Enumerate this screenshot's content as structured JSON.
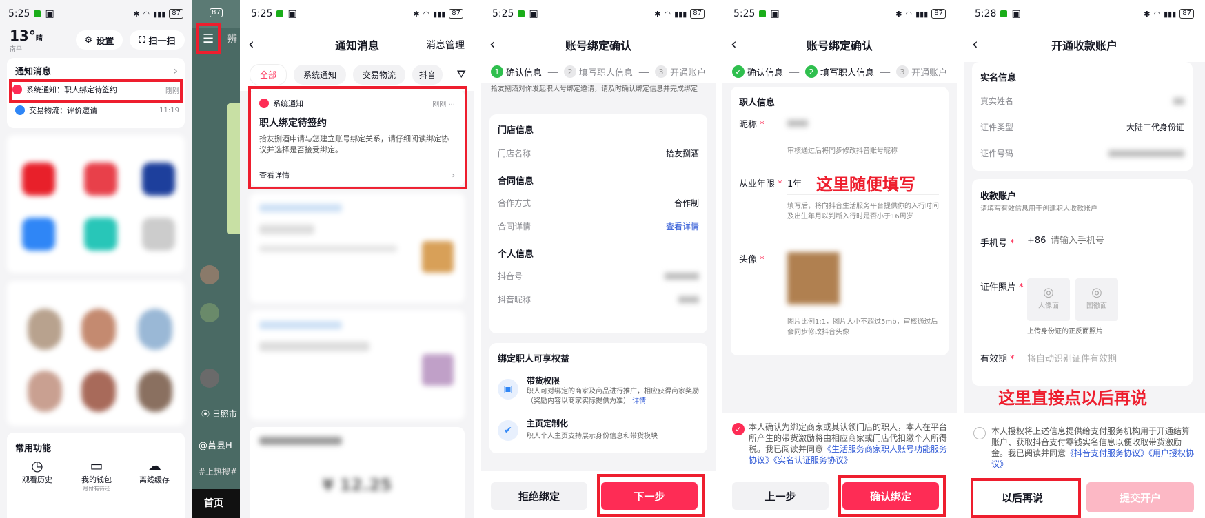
{
  "colors": {
    "brand": "#fe2c55",
    "highlight": "#ee1e2e",
    "success": "#2fbf4e",
    "link": "#2f59d6"
  },
  "p1": {
    "status": {
      "time": "5:25",
      "battery": "87"
    },
    "weather": {
      "temp": "13°",
      "cond": "晴",
      "city": "南平"
    },
    "top": {
      "settings": "设置",
      "scan": "扫一扫"
    },
    "notif": {
      "title": "通知消息",
      "items": [
        {
          "label": "系统通知：职人绑定待签约",
          "time": "刚刚"
        },
        {
          "label": "交易物流：评价邀请",
          "time": "11:19"
        }
      ]
    },
    "common": {
      "title": "常用功能",
      "items": [
        {
          "label": "观看历史"
        },
        {
          "label": "我的钱包",
          "sub": "月付有待还"
        },
        {
          "label": "离线缓存"
        }
      ]
    }
  },
  "p2": {
    "label": "辨",
    "tab": "首页",
    "tags": "#上热搜#",
    "nav": "日照市",
    "hot": "@莒县H"
  },
  "p3": {
    "status": {
      "time": "5:25",
      "battery": "87"
    },
    "title": "通知消息",
    "manage": "消息管理",
    "tabs": [
      "全部",
      "系统通知",
      "交易物流",
      "抖音"
    ],
    "card": {
      "source": "系统通知",
      "time": "刚刚",
      "title": "职人绑定待签约",
      "body": "拾友捌酒申请与您建立账号绑定关系，请仔细阅读绑定协议并选择是否接受绑定。",
      "link": "查看详情"
    },
    "amount": "¥ 12.25"
  },
  "p4": {
    "status": {
      "time": "5:25",
      "battery": "87"
    },
    "title": "账号绑定确认",
    "steps": [
      "确认信息",
      "填写职人信息",
      "开通账户"
    ],
    "intro": "拾友捌酒对你发起职人号绑定邀请，请及时确认绑定信息并完成绑定",
    "store": {
      "section": "门店信息",
      "name_label": "门店名称",
      "name": "拾友捌酒"
    },
    "contract": {
      "section": "合同信息",
      "mode_label": "合作方式",
      "mode": "合作制",
      "detail_label": "合同详情",
      "detail": "查看详情"
    },
    "personal": {
      "section": "个人信息",
      "dy_label": "抖音号",
      "nick_label": "抖音昵称"
    },
    "benefits": {
      "title": "绑定职人可享权益",
      "b1_title": "带货权限",
      "b1_desc": "职人可对绑定的商家及商品进行推广，相应获得商家奖励（奖励内容以商家实际提供为准）",
      "b1_link": "详情",
      "b2_title": "主页定制化",
      "b2_desc": "职人个人主页支持展示身份信息和带货模块"
    },
    "reject": "拒绝绑定",
    "next": "下一步"
  },
  "p5": {
    "status": {
      "time": "5:25",
      "battery": "87"
    },
    "title": "账号绑定确认",
    "steps": [
      "确认信息",
      "填写职人信息",
      "开通账户"
    ],
    "section": "职人信息",
    "nick_label": "昵称",
    "nick_hint": "审核通过后将同步修改抖音账号昵称",
    "years_label": "从业年限",
    "years": "1年",
    "annotation": "这里随便填写",
    "years_hint": "填写后，将向抖音生活服务平台提供你的入行时间及出生年月以判断入行时是否小于16周岁",
    "avatar_label": "头像",
    "avatar_hint": "图片比例1:1，图片大小不超过5mb，审核通过后会同步修改抖音头像",
    "agree_pre": "本人确认为绑定商家或其认领门店的职人，本人在平台所产生的带货激励将由相应商家或门店代扣缴个人所得税。我已阅读并同意",
    "agree_link1": "《生活服务商家职人账号功能服务协议》",
    "agree_link2": "《实名认证服务协议》",
    "prev": "上一步",
    "confirm": "确认绑定"
  },
  "p6": {
    "status": {
      "time": "5:28",
      "battery": "87"
    },
    "title": "开通收款账户",
    "realname": {
      "section": "实名信息",
      "name_label": "真实姓名",
      "type_label": "证件类型",
      "type": "大陆二代身份证",
      "num_label": "证件号码"
    },
    "account": {
      "section": "收款账户",
      "desc": "请填写有效信息用于创建职人收款账户",
      "phone_label": "手机号",
      "code": "+86",
      "phone_ph": "请输入手机号",
      "photo_label": "证件照片",
      "front": "人像面",
      "back": "国徽面",
      "photo_hint": "上传身份证的正反面照片",
      "valid_label": "有效期",
      "valid_ph": "将自动识别证件有效期"
    },
    "annotation": "这里直接点以后再说",
    "agree_pre": "本人授权将上述信息提供给支付服务机构用于开通结算账户、获取抖音支付零钱实名信息以便收取带货激励金。我已阅读并同意",
    "agree_link1": "《抖音支付服务协议》",
    "agree_link2": "《用户授权协议》",
    "later": "以后再说",
    "submit": "提交开户"
  }
}
